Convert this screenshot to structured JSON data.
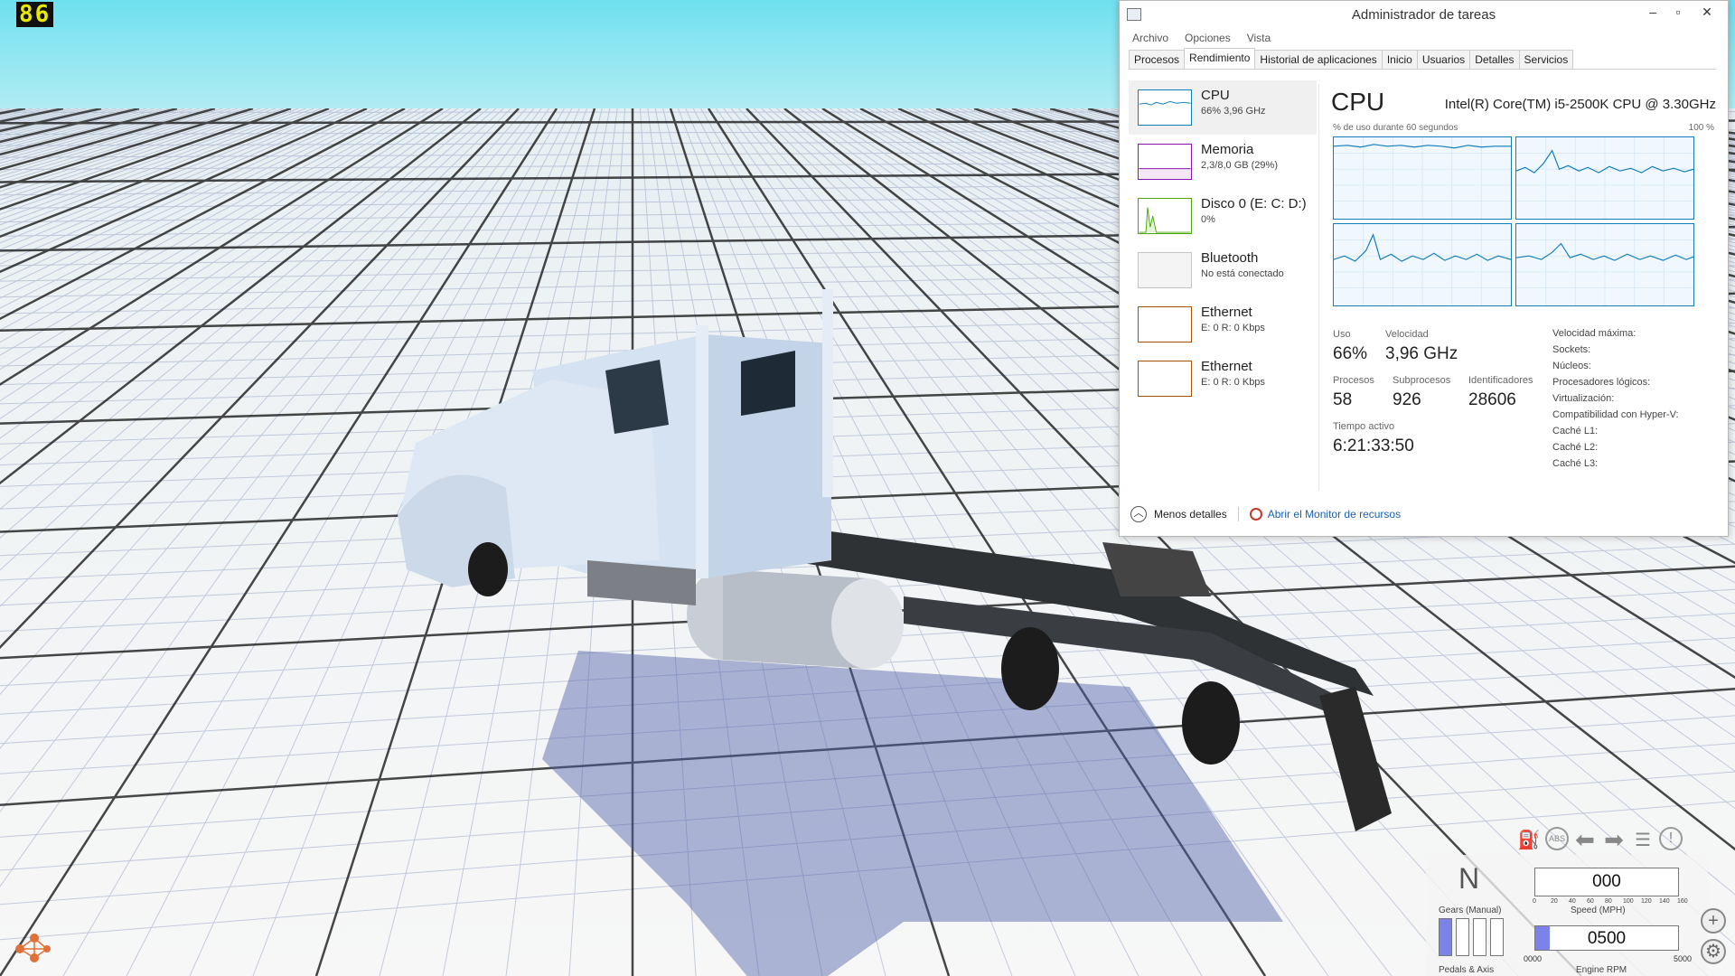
{
  "game": {
    "fps_counter": "86",
    "hud": {
      "gear": "N",
      "speed": "000",
      "speed_label": "Speed (MPH)",
      "speed_ticks": [
        "0",
        "20",
        "40",
        "60",
        "80",
        "100",
        "120",
        "140",
        "160"
      ],
      "gears_label": "Gears (Manual)",
      "pedals_label": "Pedals & Axis",
      "pedal_values": [
        "100",
        "0",
        "0",
        "0"
      ],
      "rpm": "0500",
      "rpm_min": "0000",
      "rpm_max": "5000",
      "rpm_fraction": 0.1,
      "rpm_label": "Engine RPM",
      "icons": [
        "fuel-icon",
        "abs-icon",
        "left-signal-icon",
        "right-signal-icon",
        "headlight-icon",
        "warning-icon"
      ],
      "accent_color": "#7c83e8"
    }
  },
  "taskmgr": {
    "title": "Administrador de tareas",
    "menu": [
      "Archivo",
      "Opciones",
      "Vista"
    ],
    "tabs": [
      "Procesos",
      "Rendimiento",
      "Historial de aplicaciones",
      "Inicio",
      "Usuarios",
      "Detalles",
      "Servicios"
    ],
    "active_tab": "Rendimiento",
    "sidebar": [
      {
        "name": "CPU",
        "sub": "66% 3,96 GHz",
        "color": "#117dbb"
      },
      {
        "name": "Memoria",
        "sub": "2,3/8,0 GB (29%)",
        "color": "#8b12ae"
      },
      {
        "name": "Disco 0 (E: C: D:)",
        "sub": "0%",
        "color": "#4da60c"
      },
      {
        "name": "Bluetooth",
        "sub": "No está conectado",
        "color": "#c4c4c4"
      },
      {
        "name": "Ethernet",
        "sub": "E: 0  R: 0 Kbps",
        "color": "#a74f01"
      },
      {
        "name": "Ethernet",
        "sub": "E: 0  R: 0 Kbps",
        "color": "#a74f01"
      }
    ],
    "main": {
      "title": "CPU",
      "model": "Intel(R) Core(TM) i5-2500K CPU @ 3.30GHz",
      "graph_label": "% de uso durante 60 segundos",
      "graph_max": "100 %",
      "stats": {
        "uso_label": "Uso",
        "uso": "66%",
        "velocidad_label": "Velocidad",
        "velocidad": "3,96 GHz",
        "procesos_label": "Procesos",
        "procesos": "58",
        "subprocesos_label": "Subprocesos",
        "subprocesos": "926",
        "identificadores_label": "Identificadores",
        "identificadores": "28606",
        "tiempo_label": "Tiempo activo",
        "tiempo": "6:21:33:50"
      },
      "specs": [
        "Velocidad máxima:",
        "Sockets:",
        "Núcleos:",
        "Procesadores lógicos:",
        "Virtualización:",
        "Compatibilidad con Hyper-V:",
        "Caché L1:",
        "Caché L2:",
        "Caché L3:"
      ]
    },
    "footer": {
      "less_details": "Menos detalles",
      "open_monitor": "Abrir el Monitor de recursos"
    }
  }
}
